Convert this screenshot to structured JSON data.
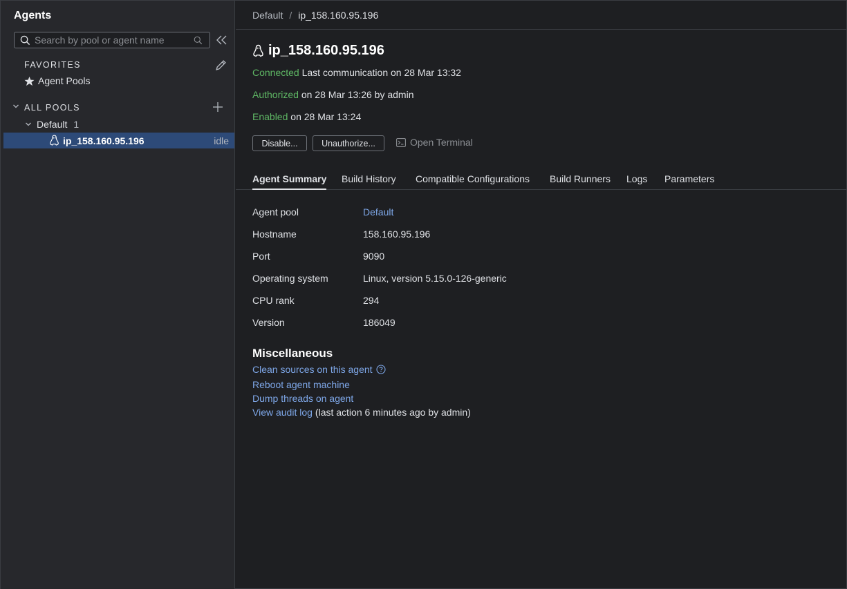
{
  "sidebar": {
    "title": "Agents",
    "search_placeholder": "Search by pool or agent name",
    "favorites_header": "FAVORITES",
    "favorites_items": [
      {
        "label": "Agent Pools"
      }
    ],
    "all_pools_header": "ALL POOLS",
    "pools": [
      {
        "name": "Default",
        "count": "1",
        "agents": [
          {
            "name": "ip_158.160.95.196",
            "status": "idle"
          }
        ]
      }
    ]
  },
  "breadcrumb": {
    "parent": "Default",
    "separator": "/",
    "current": "ip_158.160.95.196"
  },
  "agent": {
    "title": "ip_158.160.95.196",
    "connected_label": "Connected",
    "connected_text": "Last communication on 28 Mar 13:32",
    "authorized_label": "Authorized",
    "authorized_text": "on 28 Mar 13:26 by admin",
    "enabled_label": "Enabled",
    "enabled_text": "on 28 Mar 13:24"
  },
  "actions": {
    "disable": "Disable...",
    "unauthorize": "Unauthorize...",
    "open_terminal": "Open Terminal"
  },
  "tabs": [
    {
      "label": "Agent Summary",
      "active": true
    },
    {
      "label": "Build History"
    },
    {
      "label": "Compatible Configurations"
    },
    {
      "label": "Build Runners"
    },
    {
      "label": "Logs"
    },
    {
      "label": "Parameters"
    }
  ],
  "summary": [
    {
      "label": "Agent pool",
      "value": "Default",
      "link": true
    },
    {
      "label": "Hostname",
      "value": "158.160.95.196"
    },
    {
      "label": "Port",
      "value": "9090"
    },
    {
      "label": "Operating system",
      "value": "Linux, version 5.15.0-126-generic"
    },
    {
      "label": "CPU rank",
      "value": "294"
    },
    {
      "label": "Version",
      "value": "186049"
    }
  ],
  "misc": {
    "title": "Miscellaneous",
    "clean_sources": "Clean sources on this agent",
    "reboot": "Reboot agent machine",
    "dump_threads": "Dump threads on agent",
    "audit_log": "View audit log",
    "audit_note": "(last action 6 minutes ago by admin)"
  },
  "colors": {
    "background": "#1e1f22",
    "sidebar": "#27282c",
    "selected_row": "#2d4a78",
    "status_green": "#5fb865",
    "link": "#7ea7e8"
  },
  "icons": {
    "search": "search-icon",
    "clear": "clear-icon",
    "collapse": "double-chevron-left-icon",
    "edit": "pencil-icon",
    "add": "plus-icon",
    "star": "star-icon",
    "expand": "chevron-down-icon",
    "os": "linux-icon",
    "terminal": "terminal-icon",
    "help": "help-icon"
  }
}
